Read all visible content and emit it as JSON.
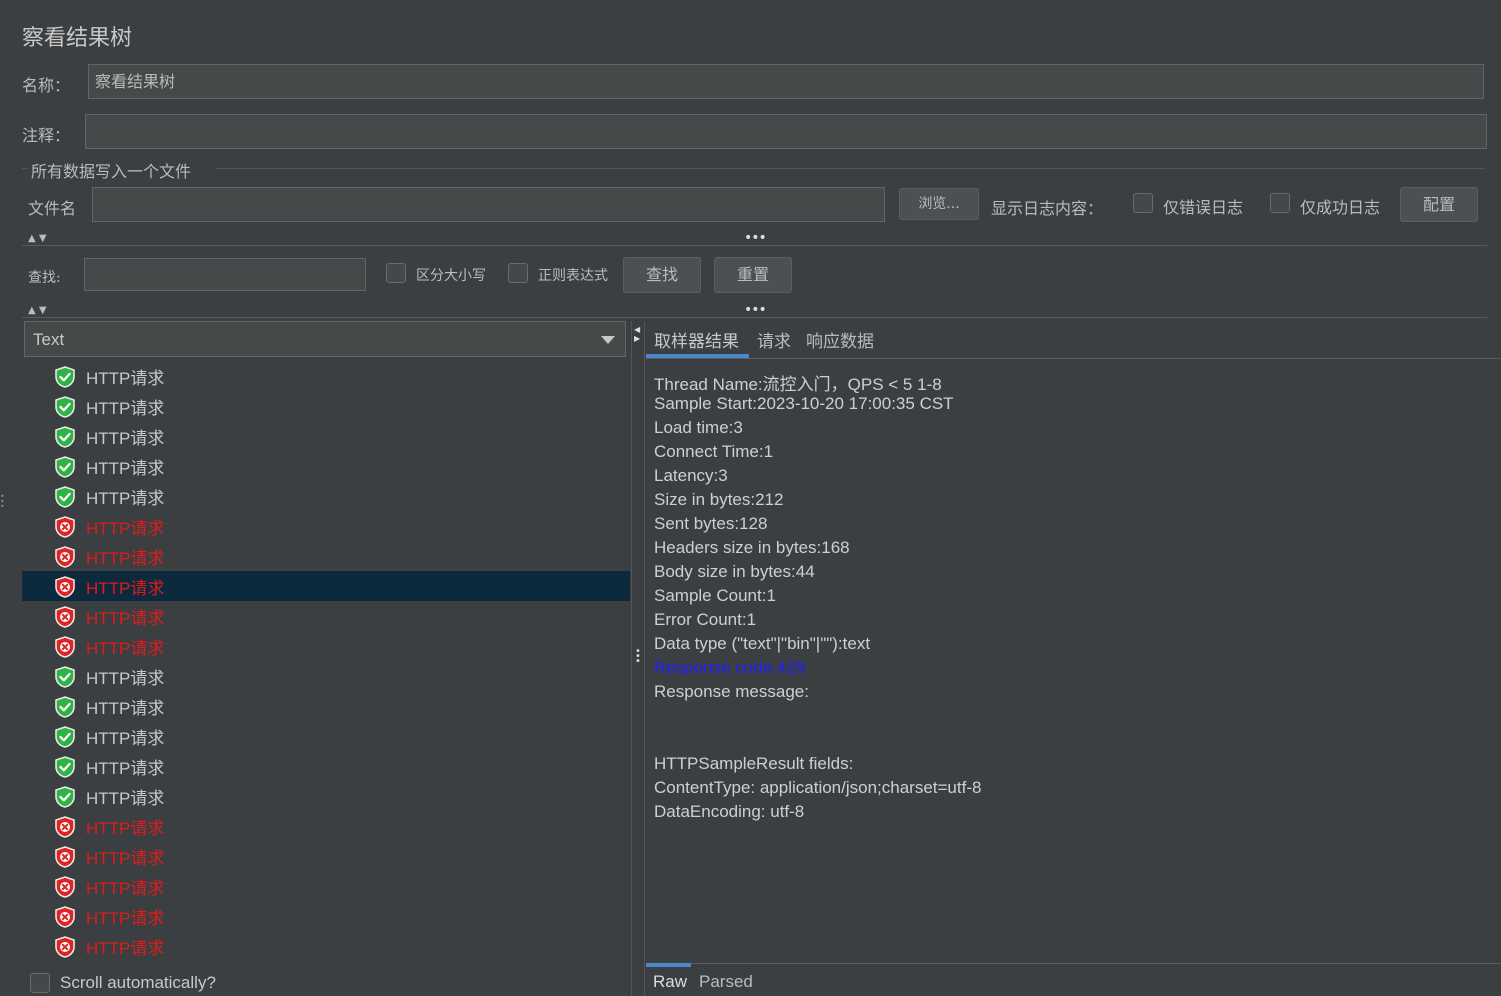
{
  "panel": {
    "title": "察看结果树",
    "name_label": "名称：",
    "name_value": "察看结果树",
    "comment_label": "注释：",
    "comment_value": ""
  },
  "file_section": {
    "legend": "所有数据写入一个文件",
    "filename_label": "文件名",
    "filename_value": "",
    "browse_label": "浏览...",
    "log_display_label": "显示日志内容：",
    "errors_only_label": "仅错误日志",
    "success_only_label": "仅成功日志",
    "configure_label": "配置"
  },
  "search": {
    "label": "查找:",
    "value": "",
    "case_sensitive_label": "区分大小写",
    "regex_label": "正则表达式",
    "find_label": "查找",
    "reset_label": "重置"
  },
  "renderer": {
    "selected": "Text"
  },
  "tree": {
    "items": [
      {
        "label": "HTTP请求",
        "status": "success"
      },
      {
        "label": "HTTP请求",
        "status": "success"
      },
      {
        "label": "HTTP请求",
        "status": "success"
      },
      {
        "label": "HTTP请求",
        "status": "success"
      },
      {
        "label": "HTTP请求",
        "status": "success"
      },
      {
        "label": "HTTP请求",
        "status": "error"
      },
      {
        "label": "HTTP请求",
        "status": "error"
      },
      {
        "label": "HTTP请求",
        "status": "error",
        "selected": true
      },
      {
        "label": "HTTP请求",
        "status": "error"
      },
      {
        "label": "HTTP请求",
        "status": "error"
      },
      {
        "label": "HTTP请求",
        "status": "success"
      },
      {
        "label": "HTTP请求",
        "status": "success"
      },
      {
        "label": "HTTP请求",
        "status": "success"
      },
      {
        "label": "HTTP请求",
        "status": "success"
      },
      {
        "label": "HTTP请求",
        "status": "success"
      },
      {
        "label": "HTTP请求",
        "status": "error"
      },
      {
        "label": "HTTP请求",
        "status": "error"
      },
      {
        "label": "HTTP请求",
        "status": "error"
      },
      {
        "label": "HTTP请求",
        "status": "error"
      },
      {
        "label": "HTTP请求",
        "status": "error"
      }
    ],
    "scroll_auto_label": "Scroll automatically?"
  },
  "tabs": {
    "sampler_result": "取样器结果",
    "request": "请求",
    "response_data": "响应数据"
  },
  "result": {
    "lines": [
      {
        "text": "Thread Name:流控入门，QPS < 5 1-8",
        "link": false
      },
      {
        "text": "Sample Start:2023-10-20 17:00:35 CST",
        "link": false
      },
      {
        "text": "Load time:3",
        "link": false
      },
      {
        "text": "Connect Time:1",
        "link": false
      },
      {
        "text": "Latency:3",
        "link": false
      },
      {
        "text": "Size in bytes:212",
        "link": false
      },
      {
        "text": "Sent bytes:128",
        "link": false
      },
      {
        "text": "Headers size in bytes:168",
        "link": false
      },
      {
        "text": "Body size in bytes:44",
        "link": false
      },
      {
        "text": "Sample Count:1",
        "link": false
      },
      {
        "text": "Error Count:1",
        "link": false
      },
      {
        "text": "Data type (\"text\"|\"bin\"|\"\"):text",
        "link": false
      },
      {
        "text": "Response code:429",
        "link": true
      },
      {
        "text": "Response message:",
        "link": false
      }
    ],
    "fields_lines": [
      "HTTPSampleResult fields:",
      "ContentType: application/json;charset=utf-8",
      "DataEncoding: utf-8"
    ]
  },
  "bottom_tabs": {
    "raw": "Raw",
    "parsed": "Parsed"
  },
  "colors": {
    "background": "#3c3f41",
    "selected_row": "#0d293e",
    "error_text": "#e01b1b",
    "link_text": "#1f1fff",
    "tab_underline": "#4a88c7"
  }
}
